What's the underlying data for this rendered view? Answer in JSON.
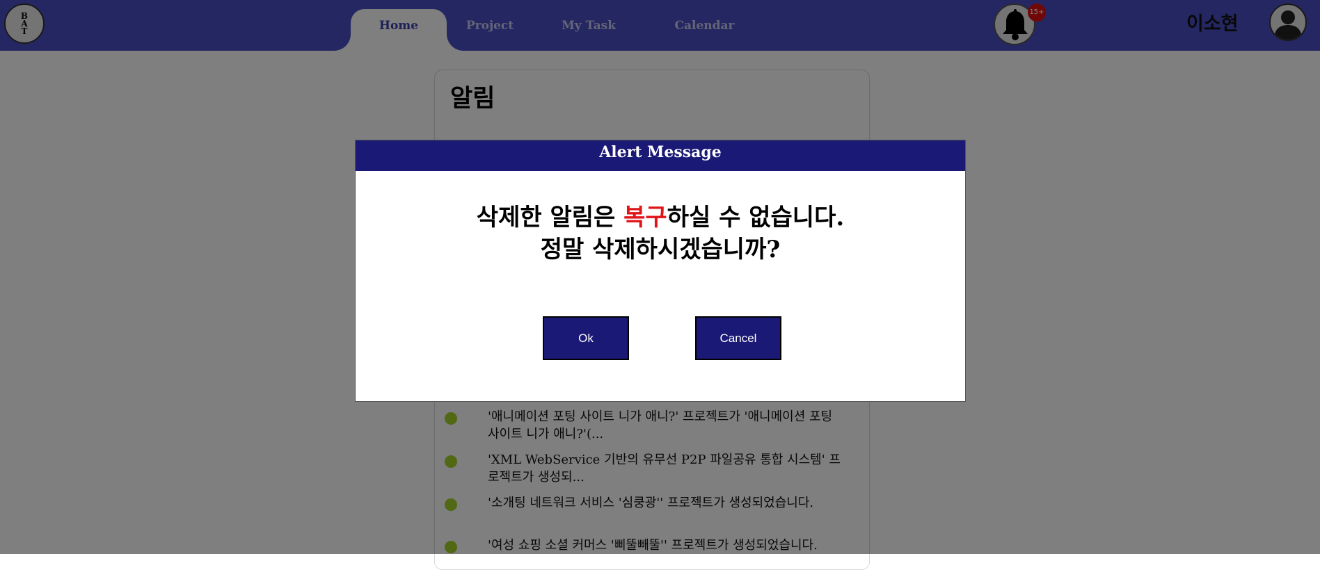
{
  "header": {
    "logo_letters": [
      "B",
      "A",
      "T"
    ],
    "tabs": [
      {
        "label": "Home",
        "active": true
      },
      {
        "label": "Project",
        "active": false
      },
      {
        "label": "My Task",
        "active": false
      },
      {
        "label": "Calendar",
        "active": false
      }
    ],
    "notification_badge": "15+",
    "username": "이소현",
    "bar_color": "#4a4fc4"
  },
  "page": {
    "title": "알림",
    "notifications": [
      {
        "text": "'애니메이션 포팅 사이트 니가 애니?' 프로젝트가 '애니메이션 포팅 사이트 니가 애니?'(..."
      },
      {
        "text": "'XML WebService 기반의 유무선 P2P 파일공유 통합 시스템' 프로젝트가 생성되..."
      },
      {
        "text": "'소개팅 네트워크 서비스 '심쿵광'' 프로젝트가 생성되었습니다."
      },
      {
        "text": "'여성 쇼핑 소셜 커머스 '삐뚤빼뚤'' 프로젝트가 생성되었습니다."
      }
    ],
    "bullet_color": "#a3d02a"
  },
  "modal": {
    "title": "Alert Message",
    "message_line1_before": "삭제한 알림은 ",
    "message_line1_emphasis": "복구",
    "message_line1_after": "하실 수 없습니다.",
    "message_line2": "정말 삭제하시겠습니까?",
    "ok_label": "Ok",
    "cancel_label": "Cancel",
    "header_color": "#1a1975",
    "emphasis_color": "#e0151a"
  }
}
